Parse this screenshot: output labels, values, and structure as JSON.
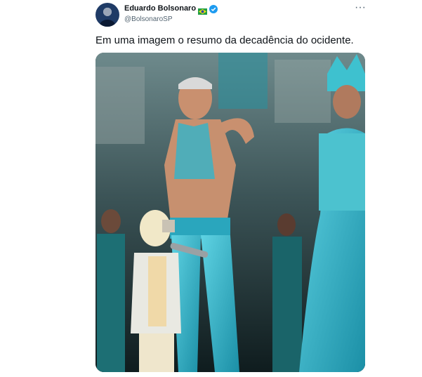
{
  "author": {
    "display_name": "Eduardo Bolsonaro",
    "handle": "@BolsonaroSP"
  },
  "tweet": {
    "text": "Em uma imagem o resumo da decadência do ocidente."
  },
  "icons": {
    "flag": "brazil-flag-icon",
    "verified": "verified-badge-icon",
    "more": "more-options-icon"
  },
  "colors": {
    "verified_blue": "#1d9bf0",
    "costume_turquoise": "#2fb3c9"
  }
}
